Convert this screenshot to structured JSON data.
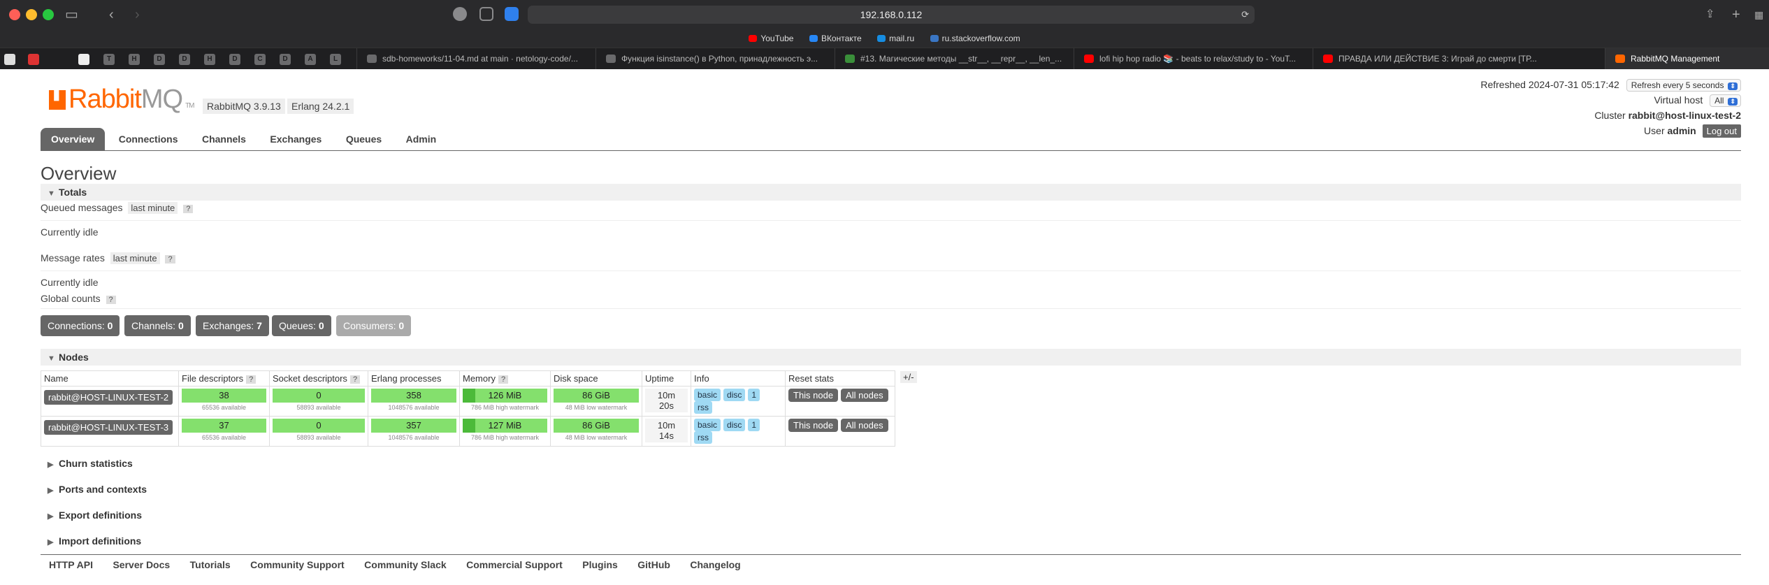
{
  "browser": {
    "url": "192.168.0.112",
    "favorites": [
      {
        "label": "YouTube",
        "color": "#ff0000"
      },
      {
        "label": "ВКонтакте",
        "color": "#2787f5"
      },
      {
        "label": "mail.ru",
        "color": "#168de2"
      },
      {
        "label": "ru.stackoverflow.com",
        "color": "#3a76c4"
      }
    ],
    "mini_tabs": [
      "",
      "",
      "",
      "T",
      "H",
      "D",
      "D",
      "H",
      "D",
      "C",
      "D",
      "A",
      "L"
    ],
    "tabs": [
      {
        "label": "sdb-homeworks/11-04.md at main · netology-code/...",
        "color": "#6a6a6c"
      },
      {
        "label": "Функция isinstance() в Python, принадлежность э...",
        "color": "#6a6a6c"
      },
      {
        "label": "#13. Магические методы __str__, __repr__, __len_...",
        "color": "#3a8f3a"
      },
      {
        "label": "lofi hip hop radio 📚 - beats to relax/study to - YouT...",
        "color": "#ff0000"
      },
      {
        "label": "ПРАВДА ИЛИ ДЕЙСТВИЕ 3: Играй до смерти [ТР...",
        "color": "#ff0000"
      },
      {
        "label": "RabbitMQ Management",
        "color": "#f60"
      }
    ]
  },
  "header": {
    "logo_rabbit": "Rabbit",
    "logo_mq": "MQ",
    "logo_tm": "TM",
    "rabbit_version": "RabbitMQ 3.9.13",
    "erlang_version": "Erlang 24.2.1",
    "refreshed": "Refreshed 2024-07-31 05:17:42",
    "refresh_select": "Refresh every 5 seconds",
    "virtual_host_label": "Virtual host",
    "virtual_host_value": "All",
    "cluster_label": "Cluster",
    "cluster_value": "rabbit@host-linux-test-2",
    "user_label": "User",
    "user_value": "admin",
    "logout": "Log out"
  },
  "menu": [
    "Overview",
    "Connections",
    "Channels",
    "Exchanges",
    "Queues",
    "Admin"
  ],
  "page_title": "Overview",
  "totals": {
    "section": "Totals",
    "queued_messages": "Queued messages",
    "message_rates": "Message rates",
    "period": "last minute",
    "help": "?",
    "idle": "Currently idle",
    "global_counts": "Global counts",
    "counts": [
      {
        "label": "Connections:",
        "value": "0"
      },
      {
        "label": "Channels:",
        "value": "0"
      },
      {
        "label": "Exchanges:",
        "value": "7"
      },
      {
        "label": "Queues:",
        "value": "0"
      },
      {
        "label": "Consumers:",
        "value": "0"
      }
    ]
  },
  "nodes": {
    "section": "Nodes",
    "plus_minus": "+/-",
    "columns": [
      "Name",
      "File descriptors",
      "Socket descriptors",
      "Erlang processes",
      "Memory",
      "Disk space",
      "Uptime",
      "Info",
      "Reset stats"
    ],
    "rows": [
      {
        "name": "rabbit@HOST-LINUX-TEST-2",
        "fd": "38",
        "fd_avail": "65536 available",
        "sd": "0",
        "sd_avail": "58893 available",
        "ep": "358",
        "ep_avail": "1048576 available",
        "mem": "126 MiB",
        "mem_sub": "786 MiB high watermark",
        "disk": "86 GiB",
        "disk_sub": "48 MiB low watermark",
        "uptime": "10m 20s",
        "info": [
          "basic",
          "disc",
          "1",
          "rss"
        ],
        "reset": [
          "This node",
          "All nodes"
        ]
      },
      {
        "name": "rabbit@HOST-LINUX-TEST-3",
        "fd": "37",
        "fd_avail": "65536 available",
        "sd": "0",
        "sd_avail": "58893 available",
        "ep": "357",
        "ep_avail": "1048576 available",
        "mem": "127 MiB",
        "mem_sub": "786 MiB high watermark",
        "disk": "86 GiB",
        "disk_sub": "48 MiB low watermark",
        "uptime": "10m 14s",
        "info": [
          "basic",
          "disc",
          "1",
          "rss"
        ],
        "reset": [
          "This node",
          "All nodes"
        ]
      }
    ]
  },
  "collapsed_sections": [
    "Churn statistics",
    "Ports and contexts",
    "Export definitions",
    "Import definitions"
  ],
  "footer": [
    "HTTP API",
    "Server Docs",
    "Tutorials",
    "Community Support",
    "Community Slack",
    "Commercial Support",
    "Plugins",
    "GitHub",
    "Changelog"
  ]
}
